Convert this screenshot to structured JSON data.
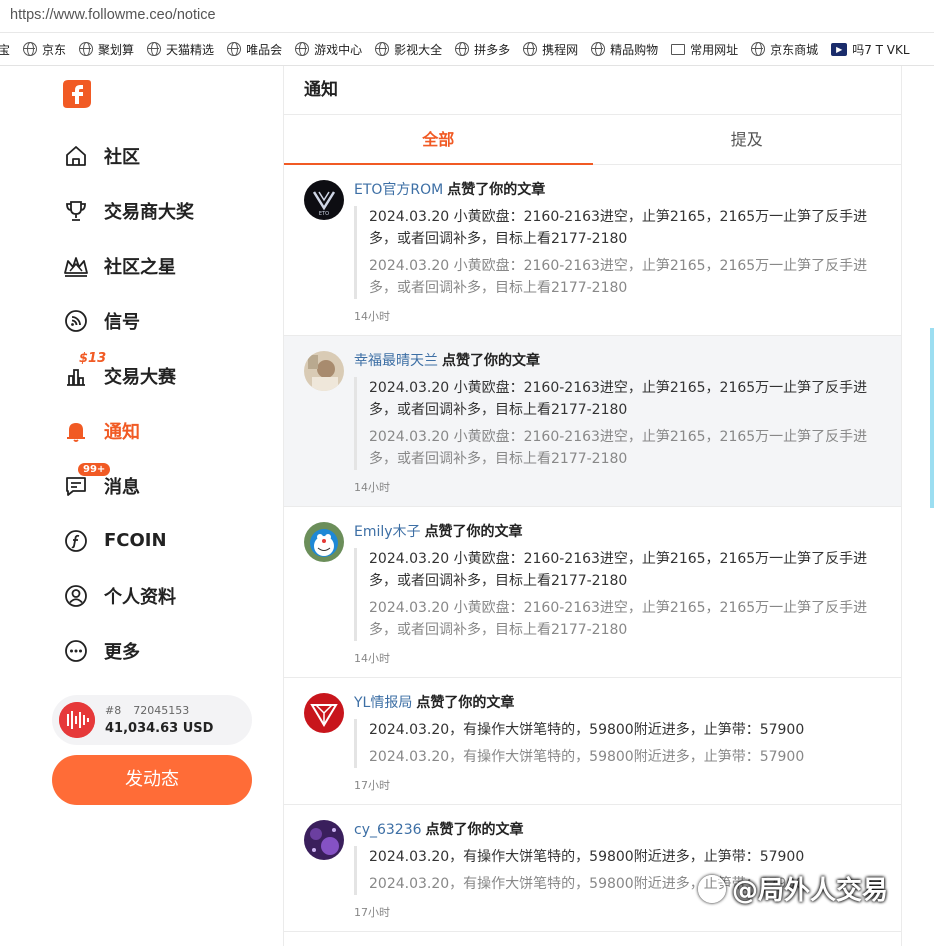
{
  "browser": {
    "url": "https://www.followme.ceo/notice",
    "bookmarks": [
      "宝",
      "京东",
      "聚划算",
      "天猫精选",
      "唯品会",
      "游戏中心",
      "影视大全",
      "拼多多",
      "携程网",
      "精品购物",
      "常用网址",
      "京东商城",
      "吗7 T VKL"
    ]
  },
  "sidebar": {
    "nav": [
      {
        "label": "社区",
        "icon": "home-icon"
      },
      {
        "label": "交易商大奖",
        "icon": "trophy-icon"
      },
      {
        "label": "社区之星",
        "icon": "crown-icon"
      },
      {
        "label": "信号",
        "icon": "signal-icon"
      },
      {
        "label": "交易大赛",
        "icon": "chart-icon",
        "badge": "$13"
      },
      {
        "label": "通知",
        "icon": "bell-icon",
        "active": true
      },
      {
        "label": "消息",
        "icon": "message-icon",
        "badge": "99+"
      },
      {
        "label": "FCOIN",
        "icon": "fcoin-icon"
      },
      {
        "label": "个人资料",
        "icon": "profile-icon"
      },
      {
        "label": "更多",
        "icon": "more-icon"
      }
    ],
    "account": {
      "rank": "#8",
      "id": "72045153",
      "balance": "41,034.63 USD"
    },
    "post_button": "发动态"
  },
  "main": {
    "title": "通知",
    "tabs": [
      {
        "label": "全部",
        "active": true
      },
      {
        "label": "提及",
        "active": false
      }
    ],
    "notices": [
      {
        "user": "ETO官方ROM",
        "action": "点赞了你的文章",
        "quote": "2024.03.20 小黄欧盘：2160-2163进空，止笋2165，2165万一止笋了反手进多，或者回调补多，目标上看2177-2180",
        "quote2": "2024.03.20 小黄欧盘：2160-2163进空，止笋2165，2165万一止笋了反手进多，或者回调补多，目标上看2177-2180",
        "time": "14小时",
        "avatar": "eto",
        "highlight": false
      },
      {
        "user": "幸福最晴天兰",
        "action": "点赞了你的文章",
        "quote": "2024.03.20 小黄欧盘：2160-2163进空，止笋2165，2165万一止笋了反手进多，或者回调补多，目标上看2177-2180",
        "quote2": "2024.03.20 小黄欧盘：2160-2163进空，止笋2165，2165万一止笋了反手进多，或者回调补多，目标上看2177-2180",
        "time": "14小时",
        "avatar": "photo",
        "highlight": true
      },
      {
        "user": "Emily木子",
        "action": "点赞了你的文章",
        "quote": "2024.03.20 小黄欧盘：2160-2163进空，止笋2165，2165万一止笋了反手进多，或者回调补多，目标上看2177-2180",
        "quote2": "2024.03.20 小黄欧盘：2160-2163进空，止笋2165，2165万一止笋了反手进多，或者回调补多，目标上看2177-2180",
        "time": "14小时",
        "avatar": "doraemon",
        "highlight": false
      },
      {
        "user": "YL情报局",
        "action": "点赞了你的文章",
        "quote": "2024.03.20，有操作大饼笔特的，59800附近进多，止笋带：57900",
        "quote2": "2024.03.20，有操作大饼笔特的，59800附近进多，止笋带：57900",
        "time": "17小时",
        "avatar": "yl",
        "highlight": false
      },
      {
        "user": "cy_63236",
        "action": "点赞了你的文章",
        "quote": "2024.03.20，有操作大饼笔特的，59800附近进多，止笋带：57900",
        "quote2": "2024.03.20，有操作大饼笔特的，59800附近进多，止笋带：57900",
        "time": "17小时",
        "avatar": "galaxy",
        "highlight": false
      }
    ]
  },
  "watermark": "@局外人交易",
  "colors": {
    "accent": "#f15a24",
    "button": "#ff6c37",
    "username": "#3d6fa5"
  }
}
